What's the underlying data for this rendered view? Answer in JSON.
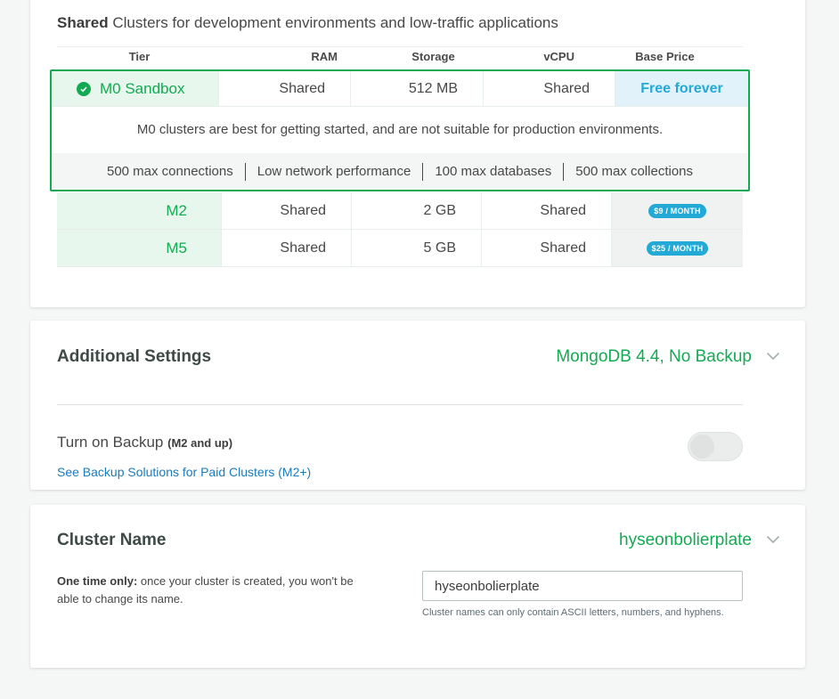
{
  "shared": {
    "title_bold": "Shared",
    "title_rest": " Clusters for development environments and low-traffic applications"
  },
  "table": {
    "headers": {
      "tier": "Tier",
      "ram": "RAM",
      "storage": "Storage",
      "vcpu": "vCPU",
      "price": "Base Price"
    },
    "selected": {
      "tier": "M0 Sandbox",
      "ram": "Shared",
      "storage": "512 MB",
      "vcpu": "Shared",
      "price": "Free forever",
      "description": "M0 clusters are best for getting started, and are not suitable for production environments.",
      "features": [
        "500 max connections",
        "Low network performance",
        "100 max databases",
        "500 max collections"
      ]
    },
    "rows": [
      {
        "tier": "M2",
        "ram": "Shared",
        "storage": "2 GB",
        "vcpu": "Shared",
        "price": "$9 / MONTH"
      },
      {
        "tier": "M5",
        "ram": "Shared",
        "storage": "5 GB",
        "vcpu": "Shared",
        "price": "$25 / MONTH"
      }
    ]
  },
  "additional_settings": {
    "title": "Additional Settings",
    "summary": "MongoDB 4.4, No Backup",
    "backup_label": "Turn on Backup",
    "backup_hint": "(M2 and up)",
    "backup_enabled": false,
    "backup_link": "See Backup Solutions for Paid Clusters (M2+)"
  },
  "cluster_name": {
    "title": "Cluster Name",
    "summary": "hyseonbolierplate",
    "note_bold": "One time only:",
    "note_rest": " once your cluster is created, you won't be able to change its name.",
    "input_value": "hyseonbolierplate",
    "help": "Cluster names can only contain ASCII letters, numbers, and hyphens."
  },
  "colors": {
    "accent_green": "#13aa52",
    "price_blue": "#23a9d6",
    "link_blue": "#1a7bbd"
  }
}
